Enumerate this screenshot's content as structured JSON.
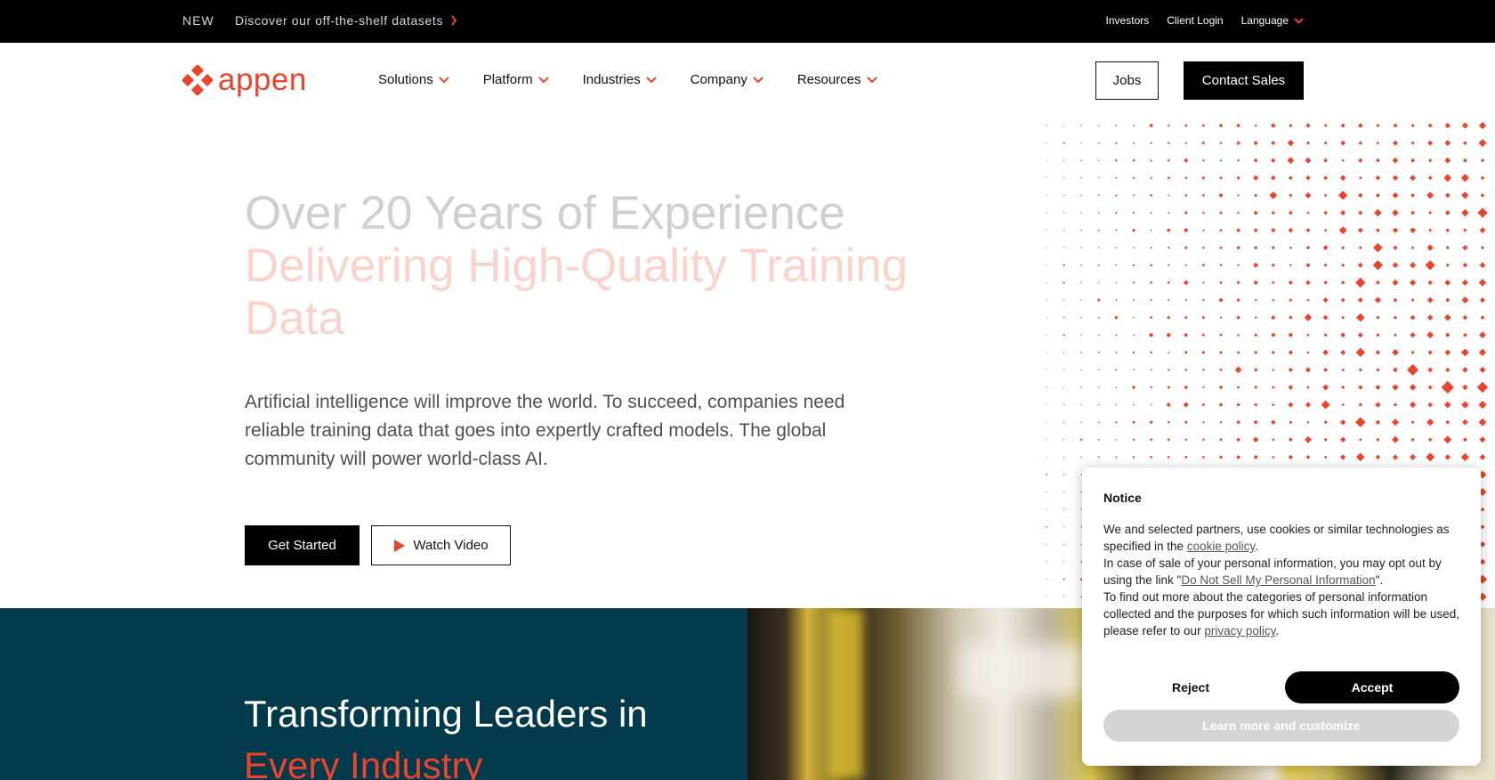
{
  "topbar": {
    "badge": "NEW",
    "announcement": "Discover our off-the-shelf datasets",
    "links": [
      "Investors",
      "Client Login"
    ],
    "language_label": "Language"
  },
  "nav": {
    "logo_text": "appen",
    "menu": [
      "Solutions",
      "Platform",
      "Industries",
      "Company",
      "Resources"
    ],
    "jobs_label": "Jobs",
    "contact_label": "Contact Sales"
  },
  "hero": {
    "headline_line1": "Over 20 Years of Experience",
    "headline_line2": "Delivering High-Quality Training Data",
    "paragraph": "Artificial intelligence will improve the world. To succeed, companies need reliable training data that goes into expertly crafted models. The global community will power world-class AI.",
    "get_started_label": "Get Started",
    "watch_video_label": "Watch Video"
  },
  "section": {
    "heading_line1": "Transforming Leaders in",
    "heading_line2": "Every Industry"
  },
  "notice": {
    "title": "Notice",
    "p1_text": "We and selected partners, use cookies or similar technologies as specified in the ",
    "p1_link": "cookie policy",
    "p1_end": ".",
    "p2_text": "In case of sale of your personal information, you may opt out by using the link \"",
    "p2_link": "Do Not Sell My Personal Information",
    "p2_end": "\".",
    "p3_text": "To find out more about the categories of personal information collected and the purposes for which such information will be used, please refer to our ",
    "p3_link": "privacy policy",
    "p3_end": ".",
    "reject_label": "Reject",
    "accept_label": "Accept",
    "learn_label": "Learn more and customize"
  },
  "colors": {
    "brand_orange": "#e8452c",
    "teal": "#033a4b",
    "black": "#000000"
  },
  "icons": [
    "chevron-right-icon",
    "chevron-down-icon",
    "appen-logo-icon",
    "play-icon"
  ]
}
